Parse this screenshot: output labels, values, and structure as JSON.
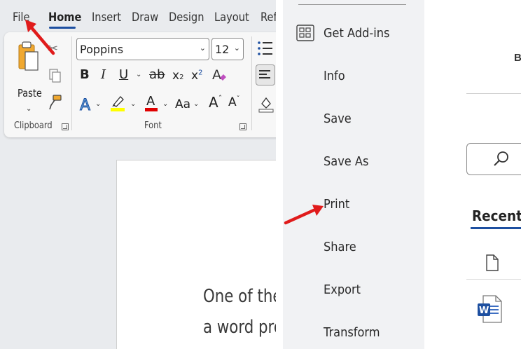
{
  "ribbon": {
    "tabs": [
      {
        "label": "File"
      },
      {
        "label": "Home"
      },
      {
        "label": "Insert"
      },
      {
        "label": "Draw"
      },
      {
        "label": "Design"
      },
      {
        "label": "Layout"
      },
      {
        "label": "Refe"
      }
    ],
    "active_tab": "Home",
    "clipboard": {
      "paste_label": "Paste",
      "group_label": "Clipboard"
    },
    "font": {
      "font_name": "Poppins",
      "font_size": "12",
      "group_label": "Font",
      "bold": "B",
      "italic": "I",
      "underline": "U",
      "strike": "ab",
      "subscript": "x",
      "subscript_mark": "2",
      "superscript": "x",
      "superscript_mark": "2",
      "font_color": "A",
      "change_case": "Aa",
      "grow": "A",
      "shrink": "A",
      "highlight_color": "#ffff00",
      "font_color_value": "#e00000"
    }
  },
  "document": {
    "line1": "One of the",
    "line2": "a word pro"
  },
  "backstage": {
    "menu": [
      {
        "label": "Get Add-ins"
      },
      {
        "label": "Info"
      },
      {
        "label": "Save"
      },
      {
        "label": "Save As"
      },
      {
        "label": "Print"
      },
      {
        "label": "Share"
      },
      {
        "label": "Export"
      },
      {
        "label": "Transform"
      }
    ]
  },
  "right_panel": {
    "partial_letter": "B",
    "recent_label": "Recent"
  },
  "colors": {
    "accent": "#1d4fa0",
    "annotation_arrow": "#e01b1b"
  }
}
